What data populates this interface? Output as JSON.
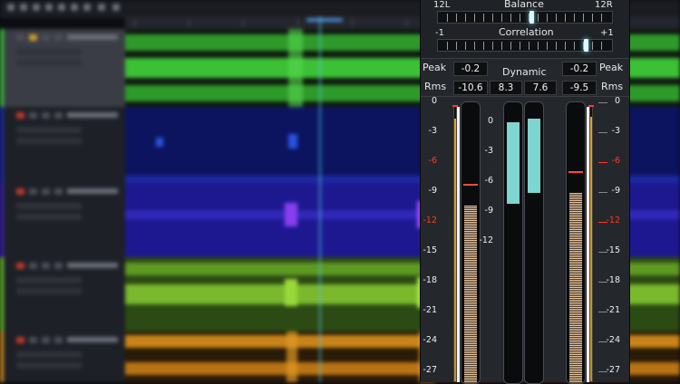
{
  "meter": {
    "balance": {
      "title": "Balance",
      "left_label": "12L",
      "right_label": "12R"
    },
    "correlation": {
      "title": "Correlation",
      "left_label": "-1",
      "right_label": "+1"
    },
    "dynamic_label": "Dynamic",
    "peak_label": "Peak",
    "rms_label": "Rms",
    "peak_left": "-0.2",
    "peak_right": "-0.2",
    "rms_left": "-10.6",
    "dynamic_left": "8.3",
    "dynamic_right": "7.6",
    "rms_right": "-9.5",
    "scale_outer": [
      "0",
      "-3",
      "-6",
      "-9",
      "-12",
      "-15",
      "-18",
      "-21",
      "-24",
      "-27"
    ],
    "scale_inner": [
      "0",
      "-3",
      "-6",
      "-9",
      "-12"
    ],
    "accent_red": "#ff3a2a",
    "accent_teal": "#7fd5cf"
  }
}
